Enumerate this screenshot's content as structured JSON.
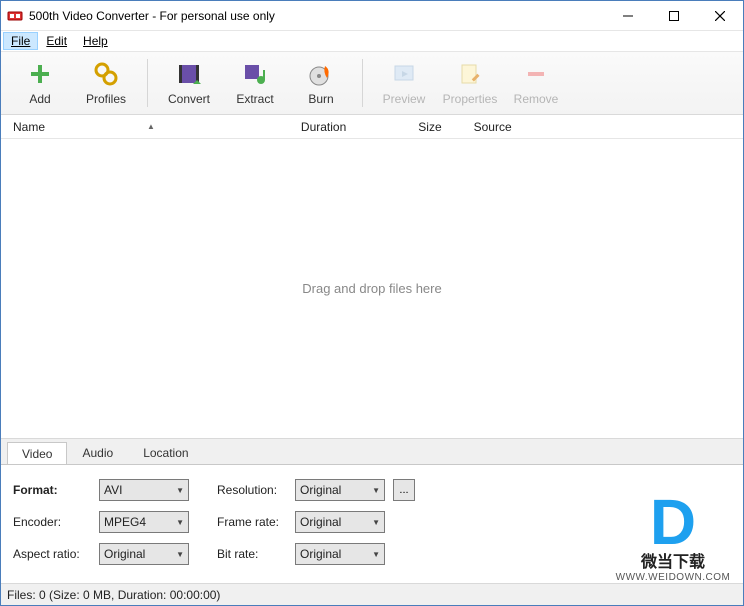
{
  "window": {
    "title": "500th Video Converter - For personal use only"
  },
  "menu": {
    "file": "File",
    "edit": "Edit",
    "help": "Help"
  },
  "toolbar": {
    "add": "Add",
    "profiles": "Profiles",
    "convert": "Convert",
    "extract": "Extract",
    "burn": "Burn",
    "preview": "Preview",
    "properties": "Properties",
    "remove": "Remove"
  },
  "columns": {
    "name": "Name",
    "duration": "Duration",
    "size": "Size",
    "source": "Source"
  },
  "dropzone": "Drag and drop files here",
  "tabs": {
    "video": "Video",
    "audio": "Audio",
    "location": "Location"
  },
  "settings": {
    "format_lbl": "Format:",
    "format_val": "AVI",
    "encoder_lbl": "Encoder:",
    "encoder_val": "MPEG4",
    "aspect_lbl": "Aspect ratio:",
    "aspect_val": "Original",
    "resolution_lbl": "Resolution:",
    "resolution_val": "Original",
    "framerate_lbl": "Frame rate:",
    "framerate_val": "Original",
    "bitrate_lbl": "Bit rate:",
    "bitrate_val": "Original",
    "more_btn": "..."
  },
  "status": "Files: 0 (Size: 0 MB, Duration: 00:00:00)",
  "watermark": {
    "logo": "D",
    "cn": "微当下载",
    "url": "WWW.WEIDOWN.COM"
  }
}
